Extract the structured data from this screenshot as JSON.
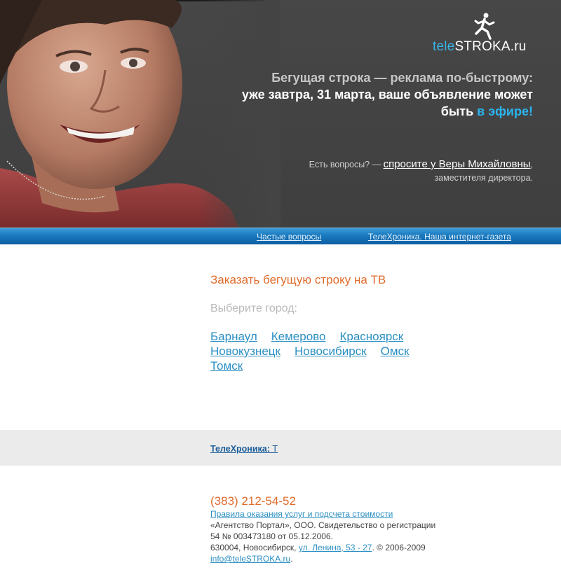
{
  "header": {
    "logo": {
      "tele": "tele",
      "rest": "STROKA.ru",
      "runner_icon": "running-man-icon"
    },
    "tagline": {
      "line1": "Бегущая строка — реклама по-быстрому:",
      "line2": "уже завтра, 31 марта, ваше объявление может",
      "line3_prefix": "быть ",
      "line3_accent": "в эфире!"
    },
    "question": {
      "prefix": "Есть вопросы? — ",
      "link": "спросите у Веры Михайловны",
      "suffix": ", заместителя директора."
    }
  },
  "nav": {
    "faq": "Частые вопросы",
    "news": "ТелеХроника. Наша интернет-газета"
  },
  "main": {
    "order_title": "Заказать бегущую строку на ТВ",
    "city_prompt": "Выберите город:",
    "cities": [
      "Барнаул",
      "Кемерово",
      "Красноярск",
      "Новокузнецк",
      "Новосибирск",
      "Омск",
      "Томск"
    ]
  },
  "band": {
    "label": "ТелеХроника:",
    "suffix": " Т"
  },
  "footer": {
    "phone": "(383) 212-54-52",
    "rules_link": "Правила оказания услуг и подсчета стоимости",
    "company": "«Агентство Портал», ООО. Свидетельство о регистрации",
    "certificate": "54 № 003473180 от 05.12.2006.",
    "address_prefix": "630004, Новосибирск, ",
    "address_link": "ул. Ленина, 53 - 27",
    "copyright": ". © 2006-2009",
    "email": "info@teleSTROKA.ru",
    "email_suffix": "."
  },
  "colors": {
    "header_bg": "#444444",
    "accent_blue": "#2bb4f0",
    "accent_orange": "#e06b2b",
    "link_blue": "#2b8fc3",
    "band_bg": "#ebebeb"
  }
}
